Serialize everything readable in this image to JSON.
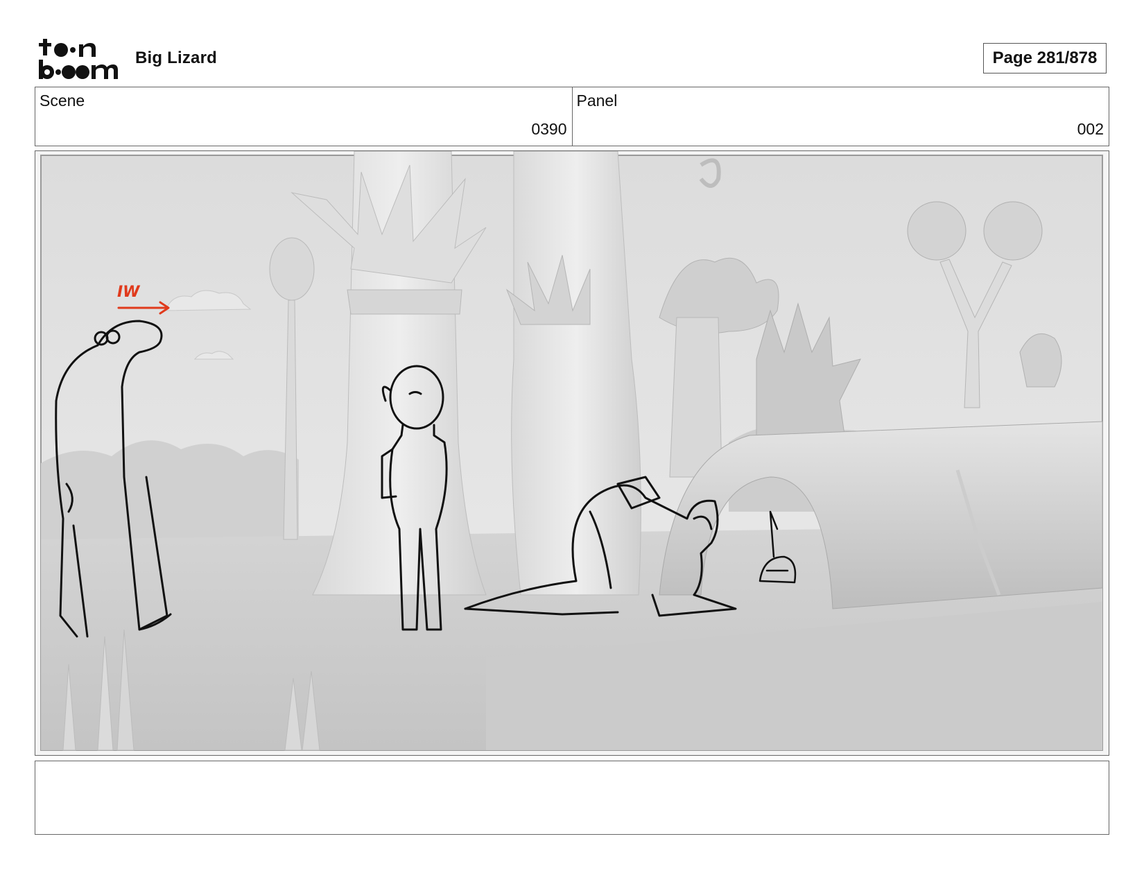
{
  "header": {
    "logo_alt": "toon boom",
    "project_title": "Big Lizard",
    "page_label": "Page 281/878"
  },
  "scene": {
    "label": "Scene",
    "value": "0390"
  },
  "panel": {
    "label": "Panel",
    "value": "002"
  },
  "panel_image": {
    "annotation": "IW",
    "annotation_color": "#e03a1c"
  },
  "notes": {
    "text": ""
  },
  "colors": {
    "border": "#666666",
    "background_render": "#e6e6e6",
    "sketch_line": "#111111"
  }
}
